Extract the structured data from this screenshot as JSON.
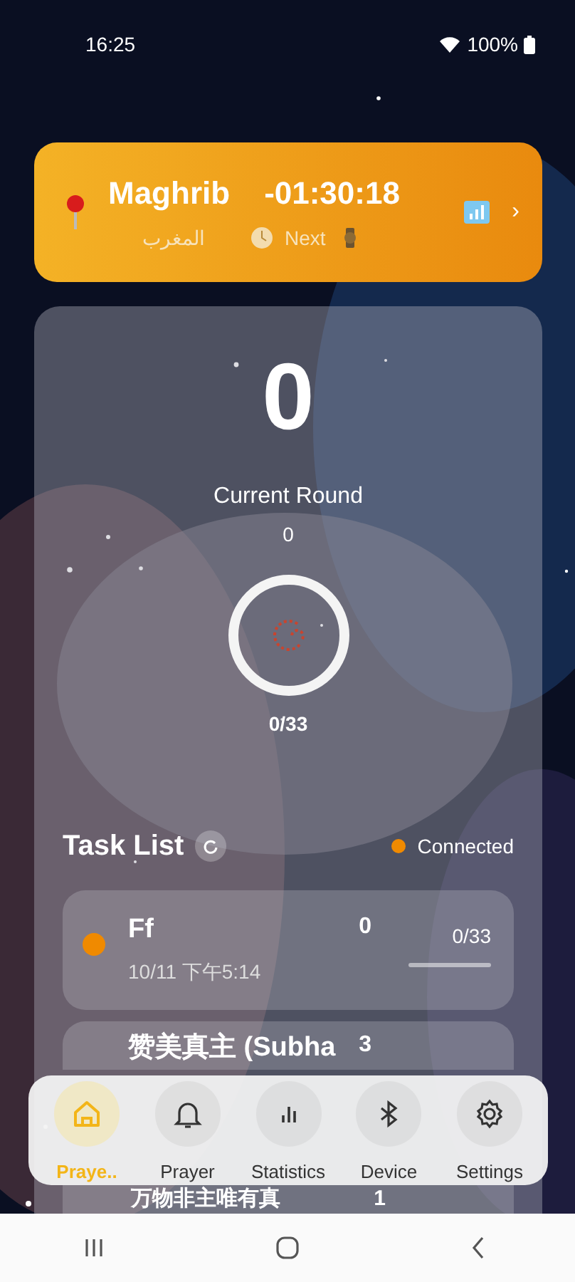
{
  "status_bar": {
    "time": "16:25",
    "battery": "100%"
  },
  "header": {
    "prayer": "Maghrib",
    "countdown": "-01:30:18",
    "arabic": "المغرب",
    "next": "Next",
    "chevron": "›"
  },
  "counter": {
    "count": "0",
    "round_label": "Current Round",
    "round": "0",
    "progress": "0/33"
  },
  "task_list": {
    "title": "Task List",
    "status": "Connected",
    "color": "#f08a00"
  },
  "tasks": [
    {
      "name": "Ff",
      "time": "10/11 下午5:14",
      "count": "0",
      "progress": "0/33",
      "level": 0,
      "color": "#f08a00"
    },
    {
      "name": "赞美真主 (Subha",
      "count": "3"
    },
    {
      "name": "万物非主唯有真",
      "count": "1"
    }
  ],
  "nav": [
    {
      "label": "Praye..",
      "kind": "home",
      "selected": true
    },
    {
      "label": "Prayer",
      "kind": "bell",
      "selected": false
    },
    {
      "label": "Statistics",
      "kind": "chart",
      "selected": false
    },
    {
      "label": "Device",
      "kind": "bluetooth",
      "selected": false
    },
    {
      "label": "Settings",
      "kind": "gear",
      "selected": false
    }
  ]
}
